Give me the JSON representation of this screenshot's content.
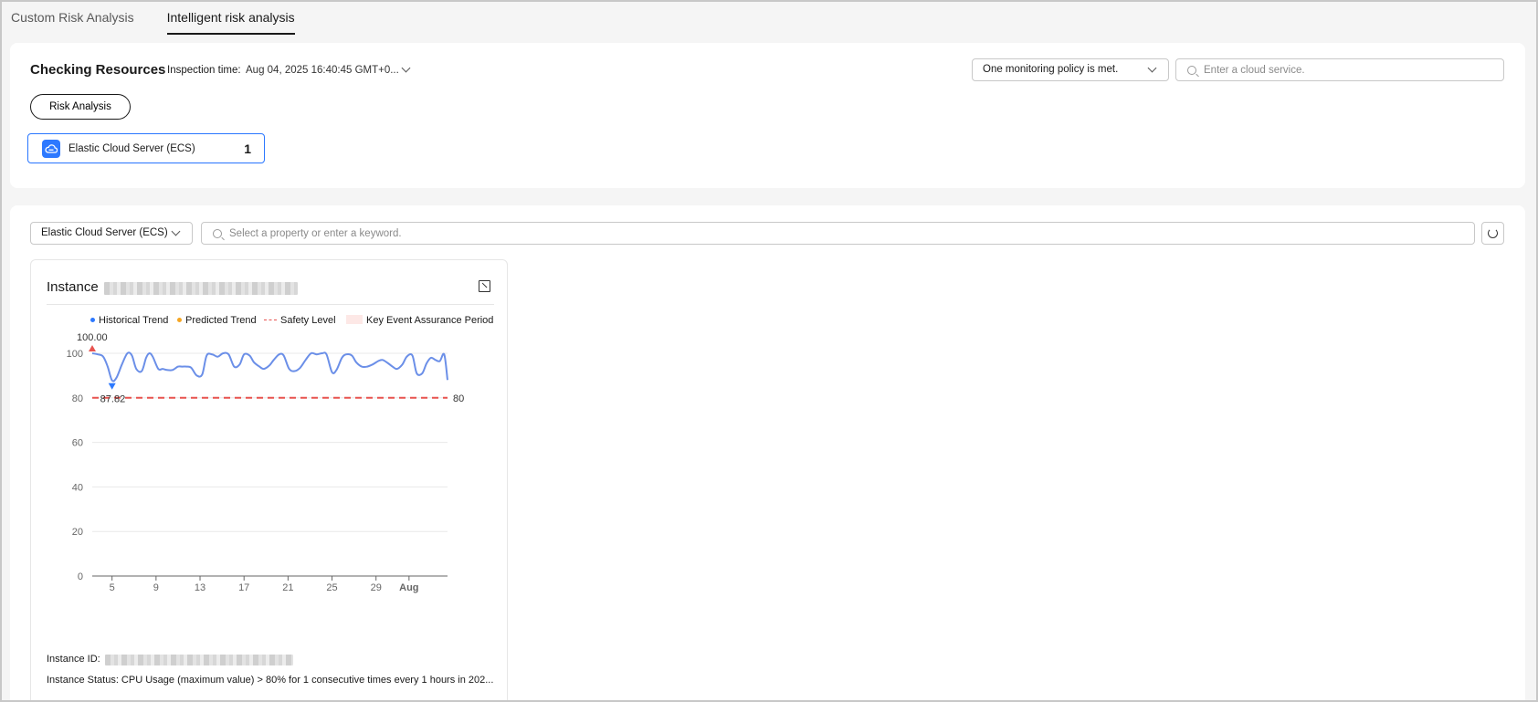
{
  "tabs": [
    {
      "label": "Custom Risk Analysis",
      "active": false
    },
    {
      "label": "Intelligent risk analysis",
      "active": true
    }
  ],
  "resources": {
    "title": "Checking Resources",
    "inspection_label": "Inspection time:",
    "inspection_value": "Aug 04, 2025 16:40:45 GMT+0...",
    "policy_select": "One monitoring policy is met.",
    "service_search_placeholder": "Enter a cloud service.",
    "risk_button": "Risk Analysis",
    "service_card": {
      "name": "Elastic Cloud Server (ECS)",
      "count": "1"
    }
  },
  "instances": {
    "service_select": "Elastic Cloud Server (ECS)",
    "search_placeholder": "Select a property or enter a keyword.",
    "card": {
      "title": "Instance",
      "instance_id_label": "Instance ID:",
      "status_text": "Instance Status: CPU Usage (maximum value) > 80% for 1 consecutive times every 1 hours in 202..."
    }
  },
  "chart_data": {
    "type": "line",
    "legend": [
      "Historical Trend",
      "Predicted Trend",
      "Safety Level",
      "Key Event Assurance Period"
    ],
    "colors": {
      "historical": "#2d79ff",
      "predicted": "#f5a623",
      "safety": "#e8534f",
      "assurance": "#fde8e6",
      "line": "#6b8fe8"
    },
    "y_ticks": [
      "0",
      "20",
      "40",
      "60",
      "80",
      "100"
    ],
    "ylim": [
      0,
      100
    ],
    "x_ticks": [
      {
        "label": "5",
        "x": 5,
        "bold": false
      },
      {
        "label": "9",
        "x": 9,
        "bold": false
      },
      {
        "label": "13",
        "x": 13,
        "bold": false
      },
      {
        "label": "17",
        "x": 17,
        "bold": false
      },
      {
        "label": "21",
        "x": 21,
        "bold": false
      },
      {
        "label": "25",
        "x": 25,
        "bold": false
      },
      {
        "label": "29",
        "x": 29,
        "bold": false
      },
      {
        "label": "Aug",
        "x": 32,
        "bold": true
      }
    ],
    "xlim": [
      3.2,
      35.5
    ],
    "series": [
      {
        "name": "Historical Trend",
        "x": [
          3.2,
          3.7,
          4.2,
          4.6,
          5.0,
          5.4,
          5.9,
          6.4,
          6.8,
          7.2,
          7.7,
          8.1,
          8.4,
          8.7,
          9.2,
          9.6,
          10.0,
          10.5,
          11.0,
          11.4,
          11.8,
          12.2,
          12.7,
          13.2,
          13.6,
          14.1,
          14.6,
          15.1,
          15.6,
          16.1,
          16.6,
          17.0,
          17.5,
          17.9,
          18.4,
          18.8,
          19.3,
          19.7,
          20.2,
          20.6,
          21.1,
          21.6,
          22.1,
          22.6,
          23.1,
          23.6,
          24.1,
          24.5,
          25.0,
          25.4,
          25.9,
          26.3,
          26.8,
          27.2,
          27.7,
          28.2,
          28.7,
          29.2,
          29.6,
          30.1,
          30.5,
          30.9,
          31.4,
          31.8,
          32.3,
          32.7,
          33.2,
          33.6,
          34.0,
          34.4,
          34.8,
          35.2,
          35.5
        ],
        "y": [
          100,
          99.5,
          98.5,
          94,
          87.82,
          89,
          95,
          100,
          99,
          93,
          92,
          98,
          100,
          98.5,
          93,
          93,
          92.5,
          92.5,
          94,
          94,
          94,
          93.5,
          90,
          90.5,
          99,
          99.5,
          98.5,
          100,
          99.5,
          94,
          95,
          99.5,
          99,
          96,
          94,
          93,
          94.5,
          97,
          99.5,
          99,
          93,
          92,
          93.5,
          97,
          100,
          99.5,
          100,
          99.5,
          91.5,
          92.5,
          98,
          99.5,
          99,
          96,
          94,
          94,
          95,
          96.5,
          97,
          95.5,
          94,
          93,
          95,
          98.5,
          99,
          91,
          91,
          95.5,
          98,
          97,
          96.5,
          99.5,
          88
        ]
      }
    ],
    "safety_level": 80,
    "annotations": [
      {
        "label": "100.00",
        "x": 3.2,
        "y": 100,
        "type": "max"
      },
      {
        "label": "87.82",
        "x": 5.0,
        "y": 87.82,
        "type": "min"
      },
      {
        "label": "80",
        "x": 35.5,
        "y": 80,
        "type": "safety"
      }
    ]
  }
}
